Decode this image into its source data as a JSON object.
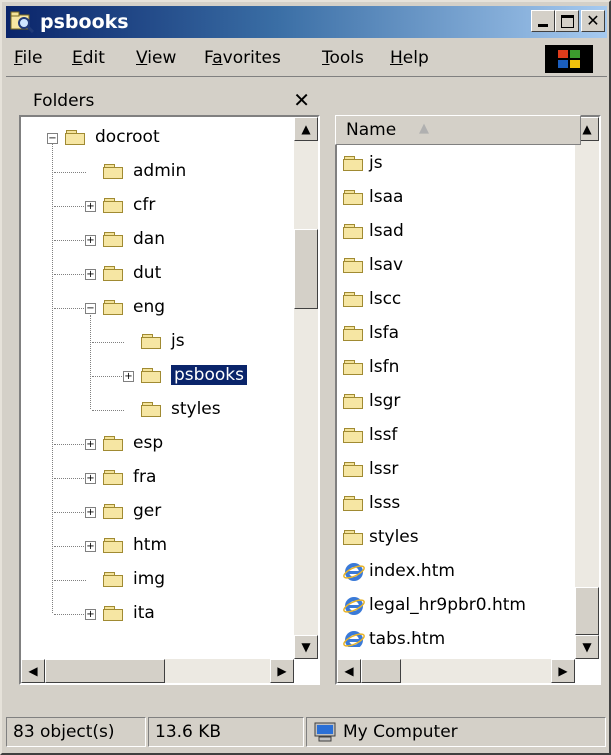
{
  "window": {
    "title": "psbooks"
  },
  "menu": [
    "File",
    "Edit",
    "View",
    "Favorites",
    "Tools",
    "Help"
  ],
  "menu_underline": [
    "F",
    "E",
    "V",
    "a",
    "T",
    "H"
  ],
  "folders_pane": {
    "title": "Folders",
    "close": "✕"
  },
  "tree": [
    {
      "label": "docroot",
      "level": 0,
      "expander": "minus",
      "selected": false
    },
    {
      "label": "admin",
      "level": 1,
      "expander": "none",
      "selected": false
    },
    {
      "label": "cfr",
      "level": 1,
      "expander": "plus",
      "selected": false
    },
    {
      "label": "dan",
      "level": 1,
      "expander": "plus",
      "selected": false
    },
    {
      "label": "dut",
      "level": 1,
      "expander": "plus",
      "selected": false
    },
    {
      "label": "eng",
      "level": 1,
      "expander": "minus",
      "selected": false
    },
    {
      "label": "js",
      "level": 2,
      "expander": "none",
      "selected": false
    },
    {
      "label": "psbooks",
      "level": 2,
      "expander": "plus",
      "selected": true
    },
    {
      "label": "styles",
      "level": 2,
      "expander": "none",
      "selected": false
    },
    {
      "label": "esp",
      "level": 1,
      "expander": "plus",
      "selected": false
    },
    {
      "label": "fra",
      "level": 1,
      "expander": "plus",
      "selected": false
    },
    {
      "label": "ger",
      "level": 1,
      "expander": "plus",
      "selected": false
    },
    {
      "label": "htm",
      "level": 1,
      "expander": "plus",
      "selected": false
    },
    {
      "label": "img",
      "level": 1,
      "expander": "none",
      "selected": false
    },
    {
      "label": "ita",
      "level": 1,
      "expander": "plus",
      "selected": false
    }
  ],
  "list": {
    "column": "Name",
    "items": [
      {
        "label": "js",
        "type": "folder"
      },
      {
        "label": "lsaa",
        "type": "folder"
      },
      {
        "label": "lsad",
        "type": "folder"
      },
      {
        "label": "lsav",
        "type": "folder"
      },
      {
        "label": "lscc",
        "type": "folder"
      },
      {
        "label": "lsfa",
        "type": "folder"
      },
      {
        "label": "lsfn",
        "type": "folder"
      },
      {
        "label": "lsgr",
        "type": "folder"
      },
      {
        "label": "lssf",
        "type": "folder"
      },
      {
        "label": "lssr",
        "type": "folder"
      },
      {
        "label": "lsss",
        "type": "folder"
      },
      {
        "label": "styles",
        "type": "folder"
      },
      {
        "label": "index.htm",
        "type": "ie"
      },
      {
        "label": "legal_hr9pbr0.htm",
        "type": "ie"
      },
      {
        "label": "tabs.htm",
        "type": "ie"
      }
    ]
  },
  "status": {
    "objects": "83 object(s)",
    "size": "13.6 KB",
    "zone": "My Computer"
  },
  "colors": {
    "title_start": "#0a246a",
    "title_end": "#a6caf0",
    "selection": "#0a246a",
    "chrome": "#d4d0c8"
  }
}
